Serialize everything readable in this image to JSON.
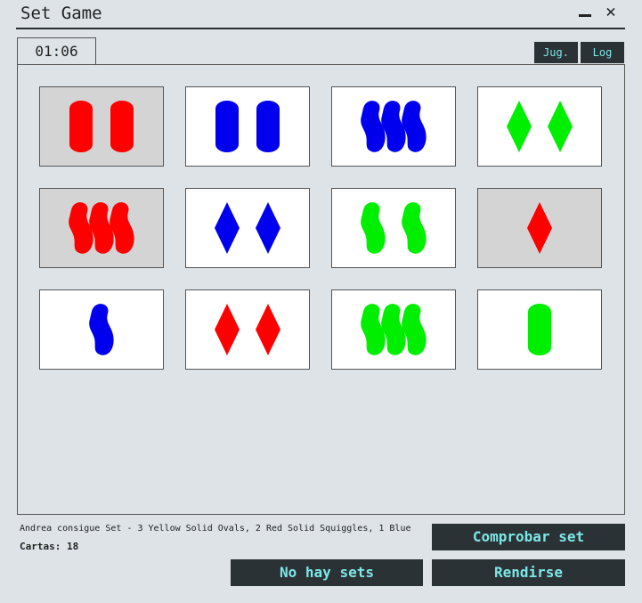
{
  "window": {
    "title": "Set Game",
    "minimize_icon": "minimize-icon",
    "close_icon": "close-icon",
    "close_glyph": "✕"
  },
  "timer": "01:06",
  "tabs": [
    {
      "label": "Jug."
    },
    {
      "label": "Log"
    }
  ],
  "colors": {
    "red": "#ff0000",
    "blue": "#0000ee",
    "green": "#00ee00",
    "selected_bg": "#d4d4d4",
    "button_bg": "#2b3235",
    "button_text": "#7de6e6"
  },
  "cards": [
    {
      "count": 2,
      "shape": "oval",
      "color": "red",
      "selected": true
    },
    {
      "count": 2,
      "shape": "oval",
      "color": "blue",
      "selected": false
    },
    {
      "count": 3,
      "shape": "squiggle",
      "color": "blue",
      "selected": false
    },
    {
      "count": 2,
      "shape": "diamond",
      "color": "green",
      "selected": false
    },
    {
      "count": 3,
      "shape": "squiggle",
      "color": "red",
      "selected": true
    },
    {
      "count": 2,
      "shape": "diamond",
      "color": "blue",
      "selected": false
    },
    {
      "count": 2,
      "shape": "squiggle",
      "color": "green",
      "selected": false
    },
    {
      "count": 1,
      "shape": "diamond",
      "color": "red",
      "selected": true
    },
    {
      "count": 1,
      "shape": "squiggle",
      "color": "blue",
      "selected": false
    },
    {
      "count": 2,
      "shape": "diamond",
      "color": "red",
      "selected": false
    },
    {
      "count": 3,
      "shape": "squiggle",
      "color": "green",
      "selected": false
    },
    {
      "count": 1,
      "shape": "oval",
      "color": "green",
      "selected": false
    }
  ],
  "status": {
    "message": "Andrea consigue Set - 3 Yellow Solid Ovals, 2 Red Solid Squiggles, 1 Blue",
    "cards_label": "Cartas: 18"
  },
  "buttons": {
    "check": "Comprobar set",
    "no_sets": "No hay sets",
    "surrender": "Rendirse"
  }
}
